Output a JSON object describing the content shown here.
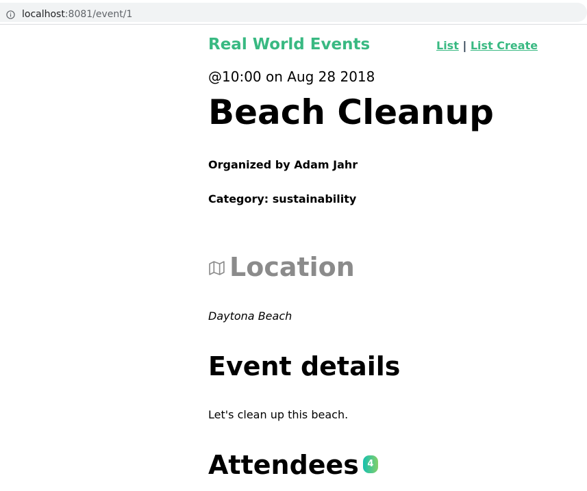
{
  "browser": {
    "url_host": "localhost",
    "url_path": ":8081/event/1"
  },
  "navbar": {
    "brand": "Real World Events",
    "links": {
      "list": "List",
      "separator": "|",
      "create": "List Create"
    }
  },
  "event": {
    "time_line": "@10:00 on Aug 28 2018",
    "title": "Beach Cleanup",
    "organizer_line": "Organized by Adam Jahr",
    "category_line": "Category: sustainability",
    "location_heading": "Location",
    "location": "Daytona Beach",
    "details_heading": "Event details",
    "description": "Let's clean up this beach.",
    "attendees_heading": "Attendees",
    "attendees_count": "4"
  },
  "colors": {
    "brand_green": "#39b982",
    "location_gray": "#8b8b8b",
    "badge_gradient_start": "#16c0b0",
    "badge_gradient_end": "#84cf6a"
  },
  "icons": {
    "url_info": "info-icon",
    "location": "map-icon"
  }
}
